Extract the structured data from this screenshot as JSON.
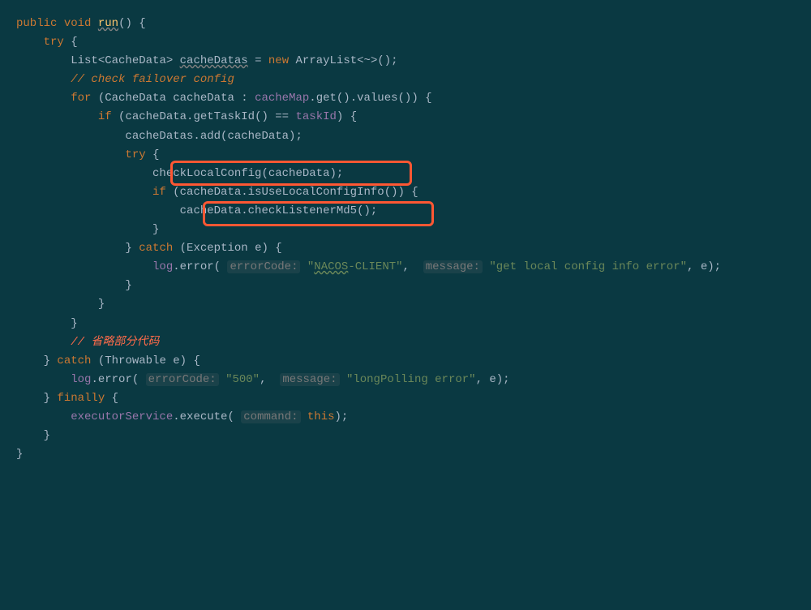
{
  "code": {
    "l1": {
      "t1": "public",
      "t2": "void",
      "t3": "run",
      "t4": "() {"
    },
    "l2": {
      "t1": "try",
      "t2": "{"
    },
    "l3": {
      "t1": "List",
      "t2": "<CacheData>",
      "t3": "cacheDatas",
      "t4": "=",
      "t5": "new",
      "t6": "ArrayList",
      "t7": "<~>",
      "t8": "();"
    },
    "l4": {
      "t1": "// check failover config"
    },
    "l5": {
      "t1": "for",
      "t2": "(CacheData cacheData : ",
      "t3": "cacheMap",
      "t4": ".get().values()) {"
    },
    "l6": {
      "t1": "if",
      "t2": "(cacheData.getTaskId() == ",
      "t3": "taskId",
      "t4": ") {"
    },
    "l7": {
      "t1": "cacheDatas.add(cacheData);"
    },
    "l8": {
      "t1": "try",
      "t2": "{"
    },
    "l9": {
      "t1": "checkLocalConfig(cacheData);"
    },
    "l10": {
      "t1": "if",
      "t2": "(cacheData.isUseLocalConfigInfo()) {"
    },
    "l11": {
      "t1": "cacheData.checkListenerMd5();"
    },
    "l12": {
      "t1": "}"
    },
    "l13": {
      "t1": "}",
      "t2": "catch",
      "t3": "(Exception e) {"
    },
    "l14": {
      "t1": "log",
      "t2": ".error(",
      "t3": "errorCode:",
      "t4": "\"",
      "t5": "NACOS",
      "t6": "-CLIENT\"",
      "t7": ",",
      "t8": "message:",
      "t9": "\"get local config info error\"",
      "t10": ", e);"
    },
    "l15": {
      "t1": "}"
    },
    "l16": {
      "t1": "}"
    },
    "l17": {
      "t1": "}"
    },
    "l18": {
      "t1": "// 省略部分代码"
    },
    "l19": {
      "t1": "}",
      "t2": "catch",
      "t3": "(Throwable e) {"
    },
    "l20": {
      "t1": "log",
      "t2": ".error(",
      "t3": "errorCode:",
      "t4": "\"500\"",
      "t5": ",",
      "t6": "message:",
      "t7": "\"longPolling error\"",
      "t8": ", e);"
    },
    "l21": {
      "t1": "}",
      "t2": "finally",
      "t3": "{"
    },
    "l22": {
      "t1": "executorService",
      "t2": ".execute(",
      "t3": "command:",
      "t4": "this",
      "t5": ");"
    },
    "l23": {
      "t1": "}"
    },
    "l24": {
      "t1": "}"
    }
  },
  "annotations": {
    "box1_target": "checkLocalConfig(cacheData);",
    "box2_target": "cacheData.checkListenerMd5();",
    "box_color": "#ff5733"
  },
  "colors": {
    "background": "#0a3942",
    "keyword": "#cc7832",
    "string": "#6a8759",
    "field": "#9876aa",
    "method": "#ffc66d",
    "default": "#a9b7c6",
    "hint": "#787878",
    "comment_red": "#ff6b4a"
  }
}
